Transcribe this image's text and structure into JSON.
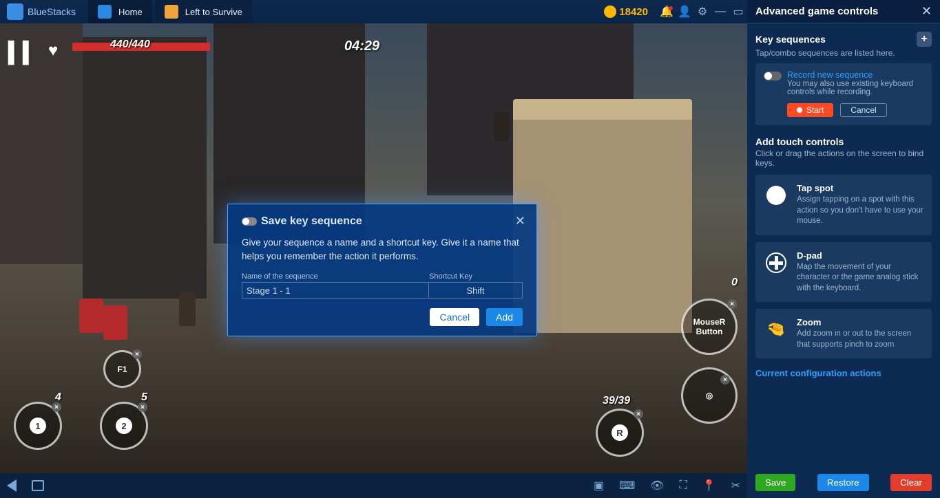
{
  "titlebar": {
    "brand": "BlueStacks",
    "tabs": [
      {
        "label": "Home"
      },
      {
        "label": "Left to Survive"
      }
    ],
    "coins": "18420"
  },
  "hud": {
    "hp": "440/440",
    "timer": "04:29",
    "f1": "F1",
    "slot1": {
      "num": "1",
      "ammo": "4"
    },
    "slot2": {
      "num": "2",
      "ammo": "5"
    },
    "right": {
      "zero": "0",
      "mouser": "MouseR Button",
      "rkey": "R",
      "ammo": "39/39"
    }
  },
  "modal": {
    "title": "Save key sequence",
    "desc": "Give your sequence a name and a shortcut key. Give it a name that helps you remember the action it performs.",
    "nameLabel": "Name of the sequence",
    "nameValue": "Stage 1 - 1",
    "keyLabel": "Shortcut Key",
    "keyValue": "Shift",
    "cancel": "Cancel",
    "add": "Add"
  },
  "panel": {
    "title": "Advanced game controls",
    "keyseq": {
      "title": "Key sequences",
      "sub": "Tap/combo sequences are listed here.",
      "recordLink": "Record new sequence",
      "recordDesc": "You may also use existing keyboard controls while recording.",
      "start": "Start",
      "cancel": "Cancel"
    },
    "touch": {
      "title": "Add touch controls",
      "sub": "Click or drag the actions on the screen to bind keys."
    },
    "cards": [
      {
        "title": "Tap spot",
        "desc": "Assign tapping on a spot with this action so you don't have to use your mouse."
      },
      {
        "title": "D-pad",
        "desc": "Map the movement of your character or the game analog stick with the keyboard."
      },
      {
        "title": "Zoom",
        "desc": "Add zoom in or out to the screen that supports pinch to zoom"
      }
    ],
    "configTitle": "Current configuration actions",
    "footer": {
      "save": "Save",
      "restore": "Restore",
      "clear": "Clear"
    }
  }
}
